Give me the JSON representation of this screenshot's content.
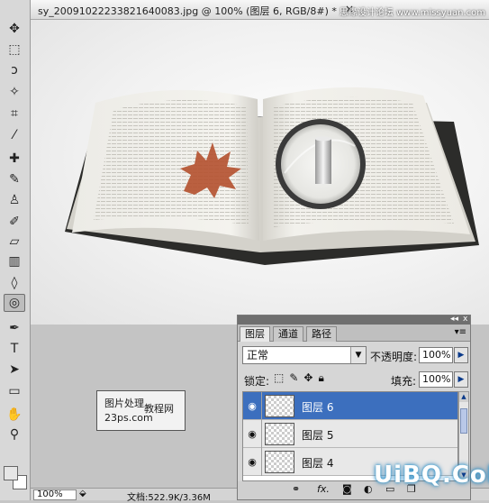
{
  "window": {
    "title": "sy_20091022233821640083.jpg @ 100% (图层 6, RGB/8#) *",
    "close_label": "×",
    "watermark": "思缘设计论坛 www.missyuan.com"
  },
  "toolbar": {
    "tools": [
      {
        "name": "move-tool",
        "glyph": "✥"
      },
      {
        "name": "marquee-tool",
        "glyph": "⬚"
      },
      {
        "name": "lasso-tool",
        "glyph": "ↄ"
      },
      {
        "name": "magic-wand-tool",
        "glyph": "✧"
      },
      {
        "name": "crop-tool",
        "glyph": "⌗"
      },
      {
        "name": "eyedropper-tool",
        "glyph": "⁄"
      },
      {
        "name": "healing-brush-tool",
        "glyph": "✚"
      },
      {
        "name": "brush-tool",
        "glyph": "✎"
      },
      {
        "name": "clone-stamp-tool",
        "glyph": "♙"
      },
      {
        "name": "history-brush-tool",
        "glyph": "✐"
      },
      {
        "name": "eraser-tool",
        "glyph": "▱"
      },
      {
        "name": "gradient-tool",
        "glyph": "▥"
      },
      {
        "name": "blur-tool",
        "glyph": "◊"
      },
      {
        "name": "dodge-tool",
        "glyph": "◎"
      },
      {
        "name": "pen-tool",
        "glyph": "✒"
      },
      {
        "name": "type-tool",
        "glyph": "T"
      },
      {
        "name": "path-selection-tool",
        "glyph": "➤"
      },
      {
        "name": "shape-tool",
        "glyph": "▭"
      },
      {
        "name": "hand-tool",
        "glyph": "✋"
      },
      {
        "name": "zoom-tool",
        "glyph": "⚲"
      }
    ],
    "foreground_color": "#e6e6e6",
    "background_color": "#ffffff"
  },
  "stamp": {
    "line1": "图片处理",
    "line1b": "教程网",
    "line2": "23ps.com"
  },
  "status": {
    "zoom": "100%",
    "doc_info": "文档:522.9K/3.36M"
  },
  "layers_panel": {
    "tabs": [
      "图层",
      "通道",
      "路径"
    ],
    "active_tab": "图层",
    "blend_mode": "正常",
    "opacity_label": "不透明度:",
    "opacity_value": "100%",
    "lock_label": "锁定:",
    "fill_label": "填充:",
    "fill_value": "100%",
    "layers": [
      {
        "name": "图层 6",
        "selected": true
      },
      {
        "name": "图层 5",
        "selected": false
      },
      {
        "name": "图层 4",
        "selected": false
      }
    ],
    "footer_icons": [
      "link-icon",
      "fx-icon",
      "mask-icon",
      "adjustment-icon",
      "group-icon",
      "new-layer-icon",
      "trash-icon"
    ]
  },
  "brand": "UiBQ.CoM",
  "colors": {
    "selected_row": "#3c6fbe",
    "panel_bg": "#d6d6d6"
  }
}
